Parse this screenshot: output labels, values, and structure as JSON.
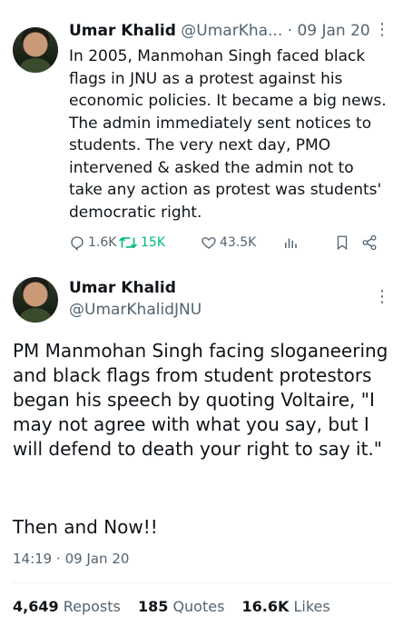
{
  "tweet1": {
    "name": "Umar Khalid",
    "handle": "@UmarKha...",
    "separator": "·",
    "date": "09 Jan 20",
    "text": "In 2005, Manmohan Singh faced black flags in JNU as a protest against his economic policies. It became a big news. The admin immediately sent notices to students. The very next day, PMO intervened & asked the admin not to take any action as protest was students' democratic right.",
    "replies": "1.6K",
    "reposts": "15K",
    "likes": "43.5K",
    "more_glyph": "⋮"
  },
  "tweet2": {
    "name": "Umar Khalid",
    "handle": "@UmarKhalidJNU",
    "text": "PM Manmohan Singh facing sloganeering and black flags from student protestors began his speech by quoting Voltaire, \"I may not agree with what you say, but I will defend to death your right to say it.\"",
    "footer": "Then and Now!!",
    "time": "14:19",
    "separator": "·",
    "date": "09 Jan 20",
    "more_glyph": "⋮",
    "stats": {
      "reposts_count": "4,649",
      "reposts_label": "Reposts",
      "quotes_count": "185",
      "quotes_label": "Quotes",
      "likes_count": "16.6K",
      "likes_label": "Likes"
    }
  },
  "colors": {
    "text": "#0f1419",
    "secondary": "#536471",
    "repost_active": "#00ba7c"
  },
  "icons": [
    "reply-icon",
    "repost-icon",
    "like-icon",
    "views-icon",
    "bookmark-icon",
    "share-icon",
    "more-icon"
  ]
}
